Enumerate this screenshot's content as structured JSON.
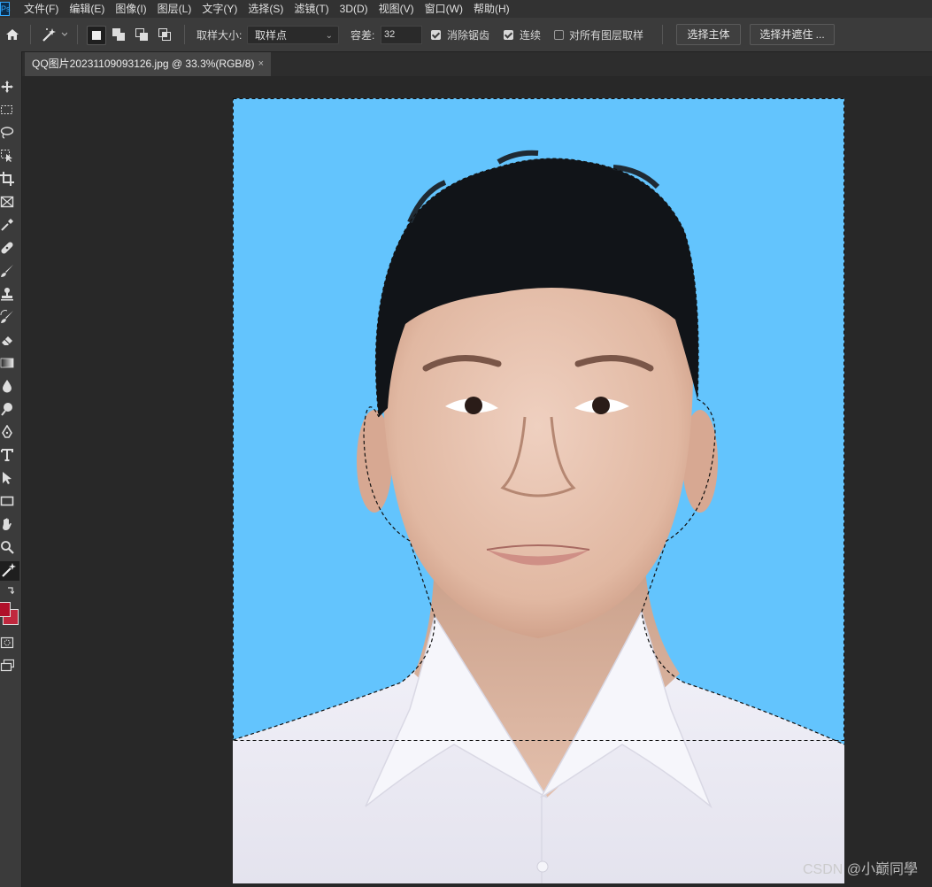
{
  "app": {
    "logo_text": "Ps"
  },
  "menu": [
    "文件(F)",
    "编辑(E)",
    "图像(I)",
    "图层(L)",
    "文字(Y)",
    "选择(S)",
    "滤镜(T)",
    "3D(D)",
    "视图(V)",
    "窗口(W)",
    "帮助(H)"
  ],
  "options": {
    "sample_size_label": "取样大小:",
    "sample_size_value": "取样点",
    "tolerance_label": "容差:",
    "tolerance_value": "32",
    "anti_alias_label": "消除锯齿",
    "anti_alias_checked": true,
    "contiguous_label": "连续",
    "contiguous_checked": true,
    "all_layers_label": "对所有图层取样",
    "all_layers_checked": false,
    "select_subject_label": "选择主体",
    "select_mask_label": "选择并遮住 ..."
  },
  "document_tab": {
    "title": "QQ图片20231109093126.jpg @ 33.3%(RGB/8)",
    "close": "×"
  },
  "tools": [
    "move-icon",
    "marquee-icon",
    "lasso-icon",
    "object-select-icon",
    "crop-icon",
    "frame-icon",
    "eyedropper-icon",
    "healing-icon",
    "brush-icon",
    "stamp-icon",
    "history-brush-icon",
    "eraser-icon",
    "gradient-icon",
    "blur-icon",
    "dodge-icon",
    "pen-icon",
    "type-icon",
    "path-select-icon",
    "rectangle-icon",
    "hand-icon",
    "zoom-icon",
    "magic-wand-icon"
  ],
  "colors": {
    "foreground": "#b0102a",
    "background": "#c0283e",
    "photo_background": "#63c4fd",
    "shirt": "#ececf4",
    "skin": "#ddb49f",
    "hair": "#111418"
  },
  "watermark": "CSDN @小巅同學"
}
